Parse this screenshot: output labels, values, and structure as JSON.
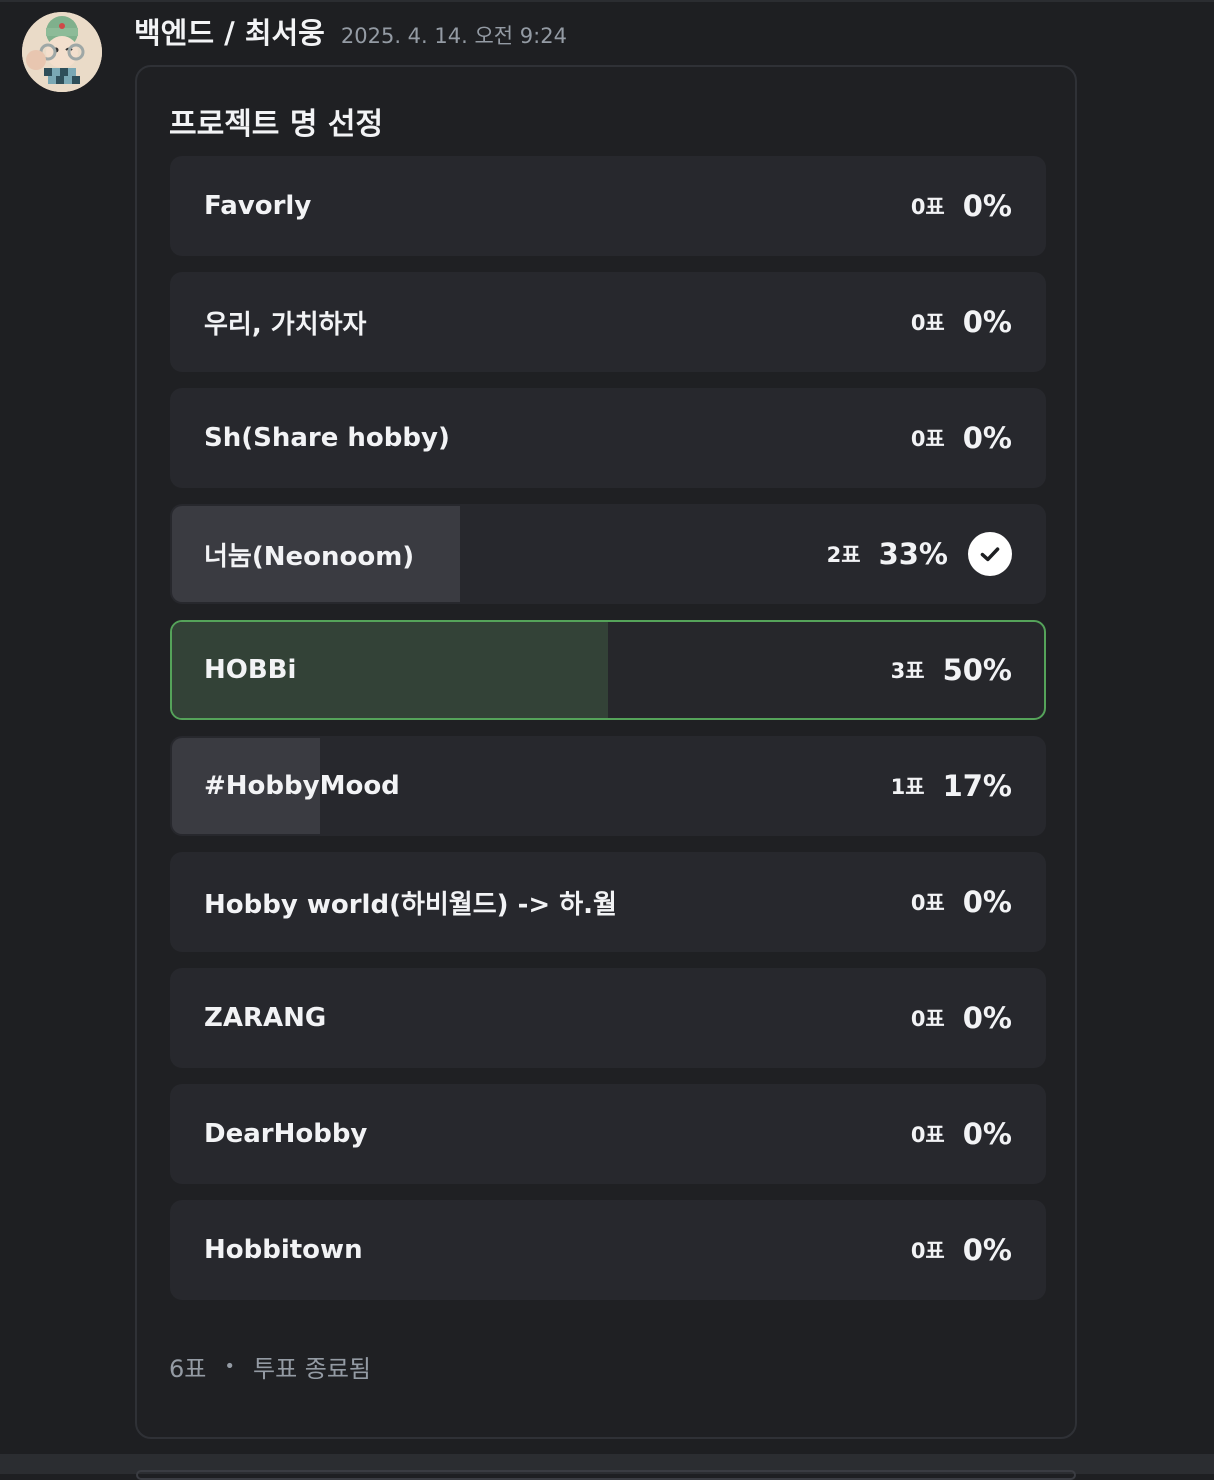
{
  "message": {
    "username": "백엔드 / 최서웅",
    "timestamp": "2025. 4. 14. 오전 9:24",
    "avatar": "avatar-illustration"
  },
  "poll": {
    "question": "프로젝트 명 선정",
    "answers": [
      {
        "label": "Favorly",
        "votes": "0표",
        "percent": "0%",
        "fraction": 0,
        "winner": false,
        "voted": false
      },
      {
        "label": "우리, 가치하자",
        "votes": "0표",
        "percent": "0%",
        "fraction": 0,
        "winner": false,
        "voted": false
      },
      {
        "label": "Sh(Share hobby)",
        "votes": "0표",
        "percent": "0%",
        "fraction": 0,
        "winner": false,
        "voted": false
      },
      {
        "label": "너눔(Neonoom)",
        "votes": "2표",
        "percent": "33%",
        "fraction": 0.33,
        "winner": false,
        "voted": true
      },
      {
        "label": "HOBBi",
        "votes": "3표",
        "percent": "50%",
        "fraction": 0.5,
        "winner": true,
        "voted": false
      },
      {
        "label": "#HobbyMood",
        "votes": "1표",
        "percent": "17%",
        "fraction": 0.17,
        "winner": false,
        "voted": false
      },
      {
        "label": "Hobby world(하비월드) -> 하.월",
        "votes": "0표",
        "percent": "0%",
        "fraction": 0,
        "winner": false,
        "voted": false
      },
      {
        "label": "ZARANG",
        "votes": "0표",
        "percent": "0%",
        "fraction": 0,
        "winner": false,
        "voted": false
      },
      {
        "label": "DearHobby",
        "votes": "0표",
        "percent": "0%",
        "fraction": 0,
        "winner": false,
        "voted": false
      },
      {
        "label": "Hobbitown",
        "votes": "0표",
        "percent": "0%",
        "fraction": 0,
        "winner": false,
        "voted": false
      }
    ],
    "total_votes": "6표",
    "separator": "•",
    "status": "투표 종료됨"
  },
  "colors": {
    "background": "#1e1f22",
    "answer_bg": "#27282d",
    "answer_fill": "#3a3b41",
    "winner_border": "#55a35a",
    "winner_fill": "#334237",
    "text": "#f2f3f5",
    "muted": "#949ba4"
  },
  "icons": {
    "voted": "checkmark-circle-icon"
  }
}
